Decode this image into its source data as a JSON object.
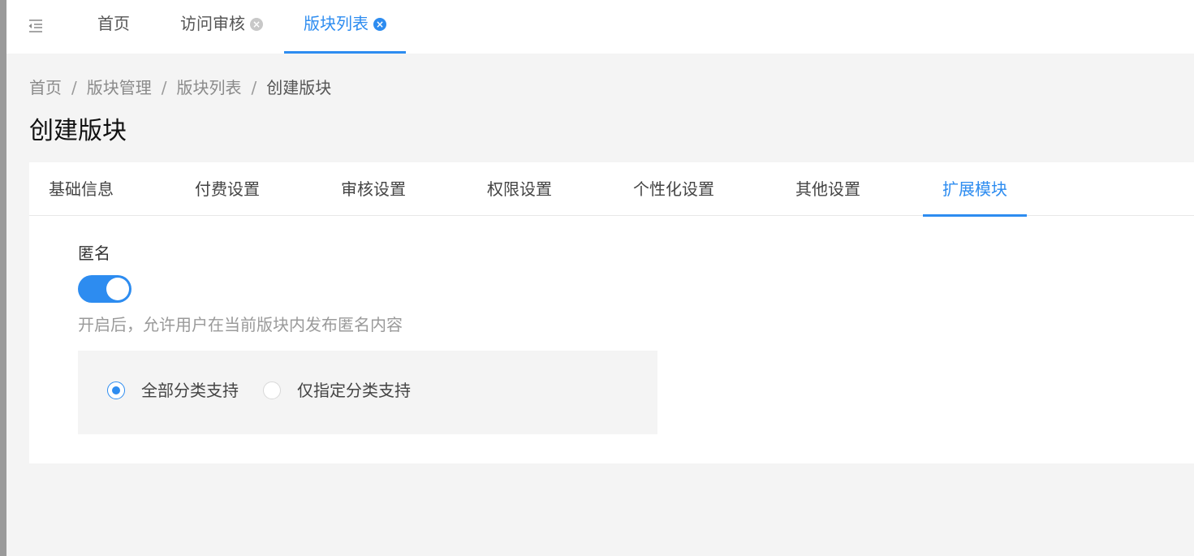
{
  "top_tabs": [
    {
      "label": "首页",
      "closable": false
    },
    {
      "label": "访问审核",
      "closable": true
    },
    {
      "label": "版块列表",
      "closable": true,
      "active": true
    }
  ],
  "breadcrumb": [
    "首页",
    "版块管理",
    "版块列表",
    "创建版块"
  ],
  "breadcrumb_separator": "/",
  "page_title": "创建版块",
  "content_tabs": [
    {
      "label": "基础信息"
    },
    {
      "label": "付费设置"
    },
    {
      "label": "审核设置"
    },
    {
      "label": "权限设置"
    },
    {
      "label": "个性化设置"
    },
    {
      "label": "其他设置"
    },
    {
      "label": "扩展模块",
      "active": true
    }
  ],
  "anonymous": {
    "label": "匿名",
    "enabled": true,
    "help": "开启后，允许用户在当前版块内发布匿名内容",
    "options": [
      {
        "label": "全部分类支持",
        "checked": true
      },
      {
        "label": "仅指定分类支持",
        "checked": false
      }
    ]
  },
  "colors": {
    "accent": "#2d8cf0",
    "page_background": "#f4f4f4"
  },
  "icons": {
    "menu_toggle": "menu-fold-icon",
    "tab_close": "close-circle-icon"
  }
}
